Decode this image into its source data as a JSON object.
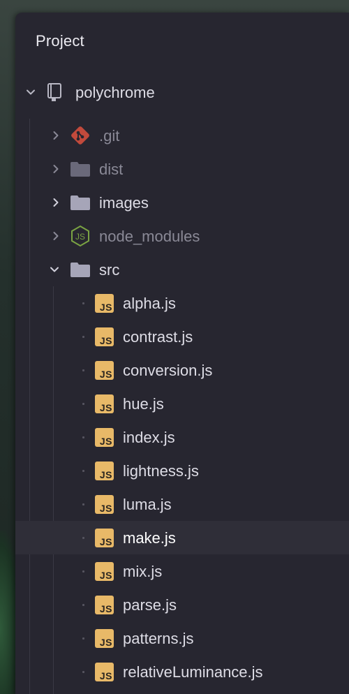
{
  "panel": {
    "title": "Project"
  },
  "root": {
    "label": "polychrome",
    "expanded": true,
    "icon": "repo-book-icon"
  },
  "children": [
    {
      "label": ".git",
      "icon": "git-icon",
      "expanded": false,
      "dim": true
    },
    {
      "label": "dist",
      "icon": "folder-icon",
      "expanded": false,
      "dim": true
    },
    {
      "label": "images",
      "icon": "folder-icon",
      "expanded": false,
      "dim": false
    },
    {
      "label": "node_modules",
      "icon": "nodejs-icon",
      "expanded": false,
      "dim": true
    },
    {
      "label": "src",
      "icon": "folder-icon",
      "expanded": true,
      "dim": false
    }
  ],
  "src_files": [
    {
      "label": "alpha.js"
    },
    {
      "label": "contrast.js"
    },
    {
      "label": "conversion.js"
    },
    {
      "label": "hue.js"
    },
    {
      "label": "index.js"
    },
    {
      "label": "lightness.js"
    },
    {
      "label": "luma.js"
    },
    {
      "label": "make.js",
      "selected": true
    },
    {
      "label": "mix.js"
    },
    {
      "label": "parse.js"
    },
    {
      "label": "patterns.js"
    },
    {
      "label": "relativeLuminance.js"
    }
  ],
  "js_badge_text": "JS",
  "colors": {
    "panel_bg": "#272630",
    "selected_row_bg": "#2f2e38",
    "js_badge": "#e8b968",
    "git_icon": "#c24a3c",
    "node_icon": "#7aa343",
    "folder_icon": "#a6a5b8"
  }
}
